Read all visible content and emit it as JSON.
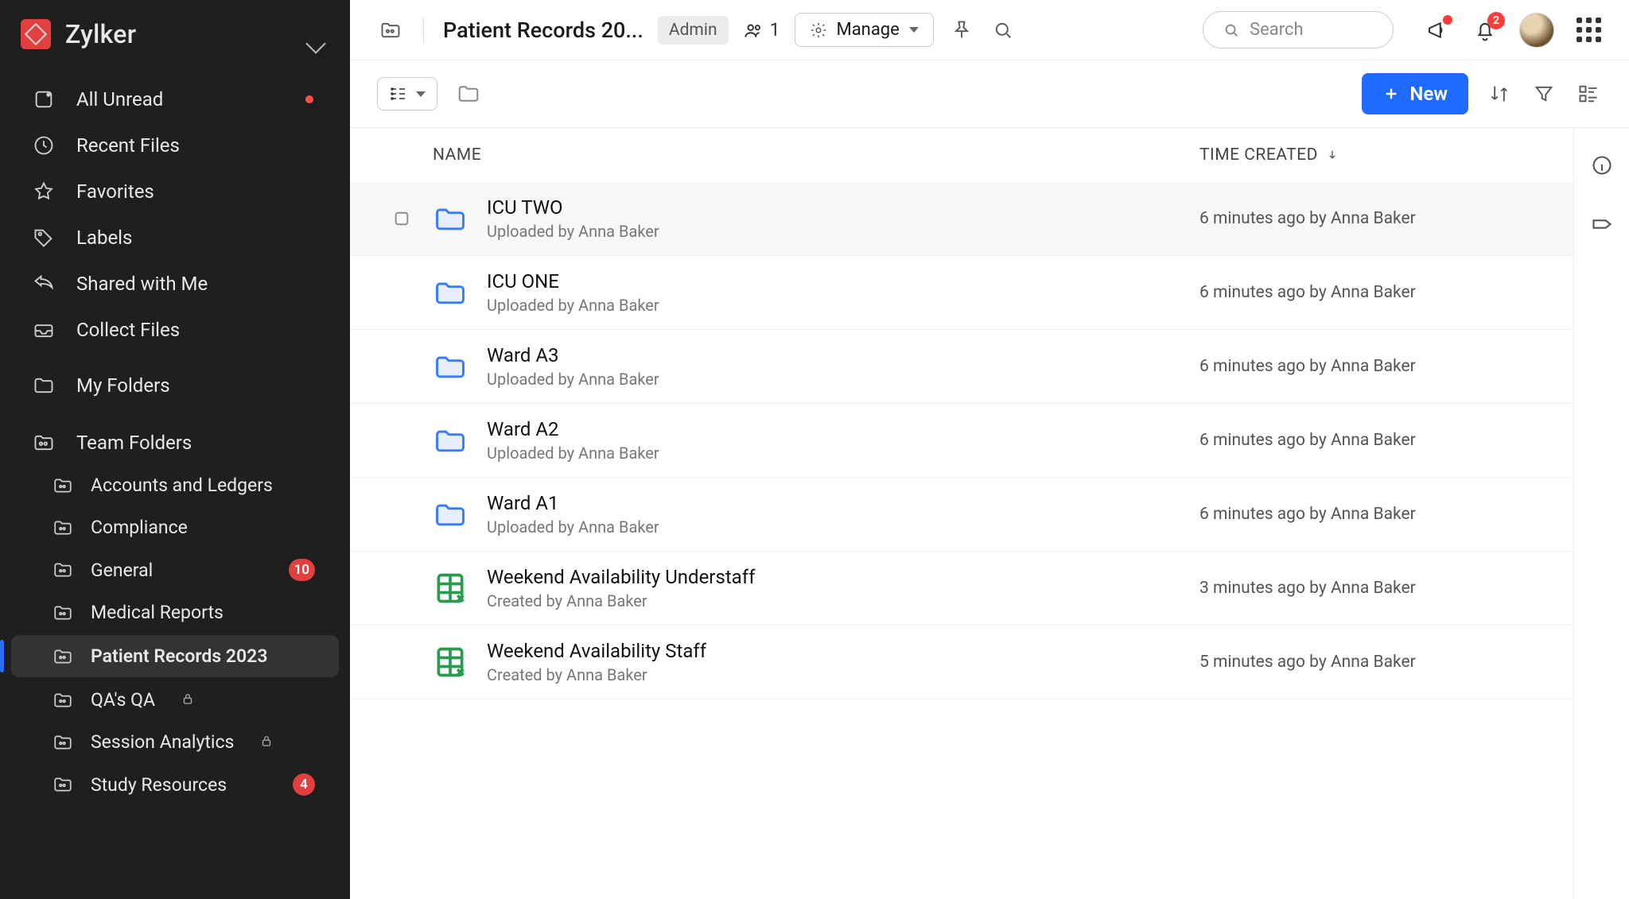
{
  "brand": {
    "name": "Zylker"
  },
  "sidebar": {
    "nav": [
      {
        "label": "All Unread",
        "icon": "unread",
        "dot": true
      },
      {
        "label": "Recent Files",
        "icon": "clock"
      },
      {
        "label": "Favorites",
        "icon": "star"
      },
      {
        "label": "Labels",
        "icon": "tag"
      },
      {
        "label": "Shared with Me",
        "icon": "reply"
      },
      {
        "label": "Collect Files",
        "icon": "inbox"
      }
    ],
    "myfolders_label": "My Folders",
    "teamfolders_label": "Team Folders",
    "team_items": [
      {
        "label": "Accounts and Ledgers"
      },
      {
        "label": "Compliance"
      },
      {
        "label": "General",
        "badge": "10"
      },
      {
        "label": "Medical Reports"
      },
      {
        "label": "Patient Records 2023",
        "active": true
      },
      {
        "label": "QA's QA",
        "locked": true
      },
      {
        "label": "Session Analytics",
        "locked": true
      },
      {
        "label": "Study Resources",
        "badge": "4"
      }
    ]
  },
  "header": {
    "crumb": "Patient Records 20...",
    "role_chip": "Admin",
    "member_count": "1",
    "manage_label": "Manage",
    "search_placeholder": "Search",
    "notification_badge": "2"
  },
  "toolbar": {
    "new_label": "New"
  },
  "columns": {
    "name": "NAME",
    "time": "TIME CREATED"
  },
  "rows": [
    {
      "type": "folder",
      "title": "ICU TWO",
      "sub": "Uploaded by Anna Baker",
      "time": "6 minutes ago by Anna Baker",
      "hover": true
    },
    {
      "type": "folder",
      "title": "ICU ONE",
      "sub": "Uploaded by Anna Baker",
      "time": "6 minutes ago by Anna Baker"
    },
    {
      "type": "folder",
      "title": "Ward A3",
      "sub": "Uploaded by Anna Baker",
      "time": "6 minutes ago by Anna Baker"
    },
    {
      "type": "folder",
      "title": "Ward A2",
      "sub": "Uploaded by Anna Baker",
      "time": "6 minutes ago by Anna Baker"
    },
    {
      "type": "folder",
      "title": "Ward A1",
      "sub": "Uploaded by Anna Baker",
      "time": "6 minutes ago by Anna Baker"
    },
    {
      "type": "sheet",
      "title": "Weekend Availability Understaff",
      "sub": "Created by Anna Baker",
      "time": "3 minutes ago by Anna Baker"
    },
    {
      "type": "sheet",
      "title": "Weekend Availability Staff",
      "sub": "Created by Anna Baker",
      "time": "5 minutes ago by Anna Baker"
    }
  ]
}
